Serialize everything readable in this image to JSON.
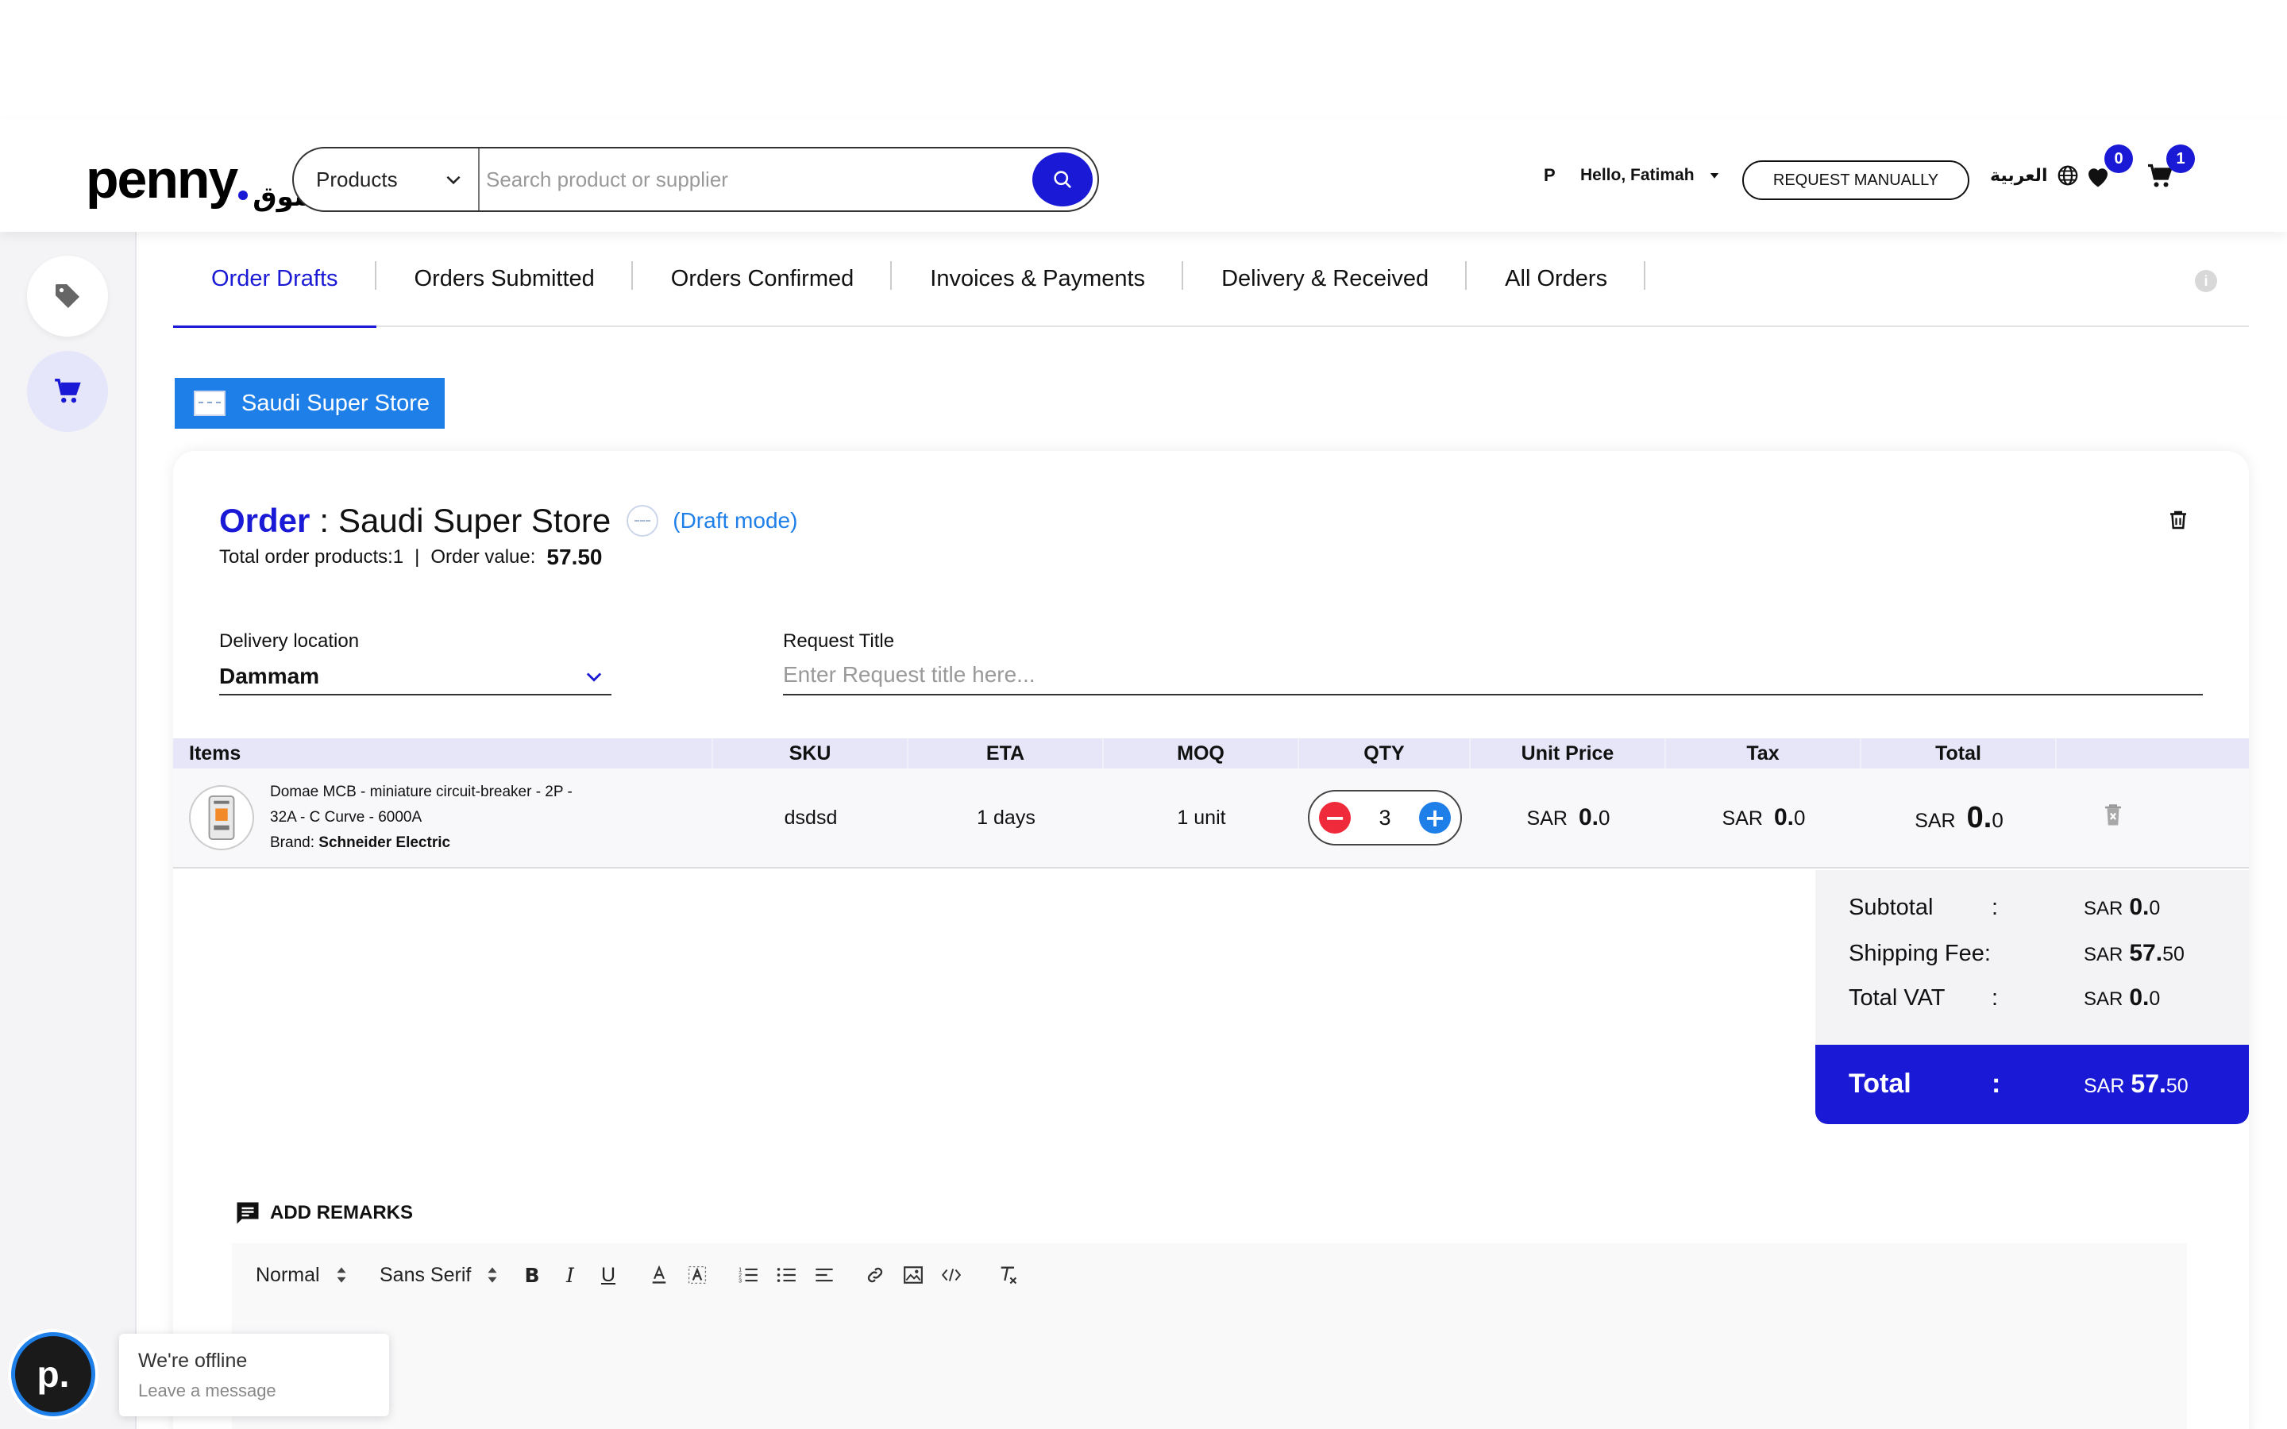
{
  "header": {
    "logo_text": "penny",
    "logo_arabic": "سوق",
    "search_category": "Products",
    "search_placeholder": "Search product or supplier",
    "user_initial": "P",
    "greeting": "Hello, Fatimah",
    "request_manually": "REQUEST MANUALLY",
    "language": "العربية",
    "wishlist_count": "0",
    "cart_count": "1",
    "accent_color": "#1a1ad6"
  },
  "sidebar": {
    "items": [
      {
        "icon": "tag-icon",
        "active": false
      },
      {
        "icon": "cart-icon",
        "active": true
      }
    ]
  },
  "tabs": [
    {
      "label": "Order Drafts",
      "active": true
    },
    {
      "label": "Orders Submitted",
      "active": false
    },
    {
      "label": "Orders Confirmed",
      "active": false
    },
    {
      "label": "Invoices & Payments",
      "active": false
    },
    {
      "label": "Delivery & Received",
      "active": false
    },
    {
      "label": "All Orders",
      "active": false
    }
  ],
  "store_chip": "Saudi Super Store",
  "order": {
    "word": "Order",
    "separator": ":",
    "store_name": "Saudi Super Store",
    "mode": "(Draft mode)",
    "total_products_label": "Total order products:1",
    "meta_sep": "|",
    "order_value_label": "Order value:",
    "order_value": "57.50",
    "delivery_label": "Delivery location",
    "delivery_value": "Dammam",
    "request_title_label": "Request Title",
    "request_title_placeholder": "Enter Request title here..."
  },
  "table": {
    "headers": [
      "Items",
      "SKU",
      "ETA",
      "MOQ",
      "QTY",
      "Unit Price",
      "Tax",
      "Total"
    ],
    "rows": [
      {
        "name_line1": "Domae MCB - miniature circuit-breaker - 2P -",
        "name_line2": "32A - C Curve - 6000A",
        "brand_label": "Brand:",
        "brand": "Schneider Electric",
        "sku": "dsdsd",
        "eta": "1 days",
        "moq": "1 unit",
        "qty": "3",
        "currency": "SAR",
        "unit_price_int": "0.",
        "unit_price_dec": "0",
        "tax_int": "0.",
        "tax_dec": "0",
        "total_int": "0.",
        "total_dec": "0"
      }
    ]
  },
  "summary": {
    "currency": "SAR",
    "subtotal_label": "Subtotal",
    "subtotal_colon": ":",
    "subtotal_int": "0.",
    "subtotal_dec": "0",
    "shipping_label": "Shipping Fee:",
    "shipping_int": "57.",
    "shipping_dec": "50",
    "vat_label": "Total VAT",
    "vat_colon": ":",
    "vat_int": "0.",
    "vat_dec": "0",
    "total_label": "Total",
    "total_colon": ":",
    "total_int": "57.",
    "total_dec": "50"
  },
  "remarks": {
    "title": "ADD REMARKS",
    "format_select": "Normal",
    "font_select": "Sans Serif"
  },
  "chat": {
    "avatar_letter": "p.",
    "status": "We're offline",
    "action": "Leave a message"
  }
}
